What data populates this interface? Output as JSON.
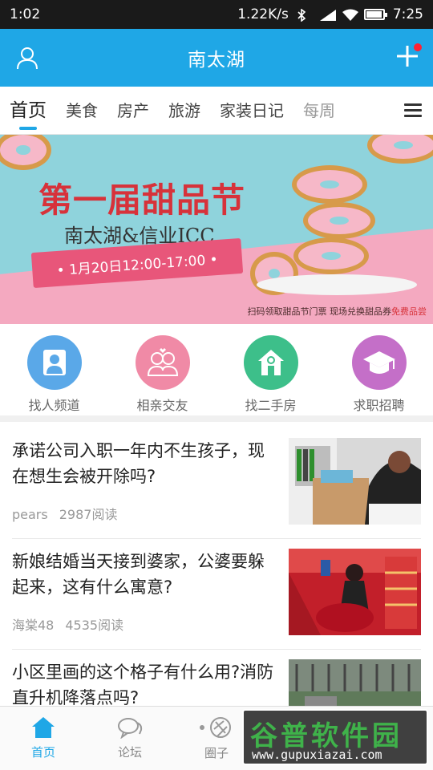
{
  "status_bar": {
    "time_left": "1:02",
    "net_speed": "1.22K/s",
    "time_right": "7:25"
  },
  "header": {
    "title": "南太湖",
    "has_notification_dot": true,
    "accent_color": "#1fa7e6"
  },
  "tabs": [
    {
      "label": "首页",
      "active": true
    },
    {
      "label": "美食"
    },
    {
      "label": "房产"
    },
    {
      "label": "旅游"
    },
    {
      "label": "家装日记"
    },
    {
      "label": "每周"
    }
  ],
  "banner": {
    "title": "第一届甜品节",
    "subtitle": "南太湖&信业ICC",
    "date_ribbon": "• 1月20日12:00-17:00 •",
    "footer_text": "扫码领取甜品节门票  现场兑换甜品券",
    "footer_highlight": "免费品尝"
  },
  "quick_entries": [
    {
      "label": "找人频道",
      "icon": "person-search-icon",
      "color": "#5aa8e8"
    },
    {
      "label": "相亲交友",
      "icon": "couple-icon",
      "color": "#f08aa6"
    },
    {
      "label": "找二手房",
      "icon": "house-icon",
      "color": "#3dbf8a"
    },
    {
      "label": "求职招聘",
      "icon": "graduation-cap-icon",
      "color": "#c46fc8"
    }
  ],
  "articles": [
    {
      "title": "承诺公司入职一年内不生孩子，现在想生会被开除吗?",
      "author": "pears",
      "reads": "2987阅读"
    },
    {
      "title": "新娘结婚当天接到婆家，公婆要躲起来，这有什么寓意?",
      "author": "海棠48",
      "reads": "4535阅读"
    },
    {
      "title": "小区里画的这个格子有什么用?消防直升机降落点吗?",
      "author": "",
      "reads": ""
    }
  ],
  "bottom_nav": [
    {
      "label": "首页",
      "icon": "home-icon",
      "active": true
    },
    {
      "label": "论坛",
      "icon": "chat-bubble-icon"
    },
    {
      "label": "圈子",
      "icon": "circle-icon"
    }
  ],
  "watermark": {
    "text": "谷普软件园",
    "url": "www.gupuxiazai.com"
  }
}
